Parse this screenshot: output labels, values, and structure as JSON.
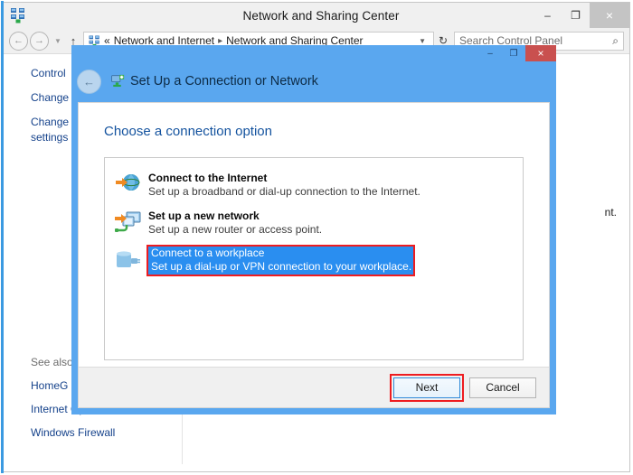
{
  "window": {
    "title": "Network and Sharing Center",
    "icon": "network-icon",
    "controls": {
      "minimize": "–",
      "maximize": "❐",
      "close": "×"
    }
  },
  "navbar": {
    "back": "←",
    "forward": "→",
    "recent_chevron": "▼",
    "up": "↑",
    "breadcrumb_prefix": "«",
    "crumbs": [
      "Network and Internet",
      "Network and Sharing Center"
    ],
    "crumb_separator": "▸",
    "address_dropdown": "▼",
    "refresh": "↻",
    "search_placeholder": "Search Control Panel",
    "search_icon": "⌕"
  },
  "sidebar": {
    "top_links": [
      "Control",
      "Change",
      "Change",
      "settings"
    ],
    "see_also_label": "See also",
    "see_also_links": [
      "HomeG",
      "Internet Options",
      "Windows Firewall"
    ]
  },
  "content_fragment": "nt.",
  "dialog": {
    "title": "Set Up a Connection or Network",
    "title_icon": "network-setup-icon",
    "back_icon": "←",
    "controls": {
      "minimize": "–",
      "maximize": "❐",
      "close": "×"
    },
    "heading": "Choose a connection option",
    "options": [
      {
        "icon": "globe-internet-icon",
        "title": "Connect to the Internet",
        "desc": "Set up a broadband or dial-up connection to the Internet.",
        "selected": false
      },
      {
        "icon": "new-network-icon",
        "title": "Set up a new network",
        "desc": "Set up a new router or access point.",
        "selected": false
      },
      {
        "icon": "workplace-vpn-icon",
        "title": "Connect to a workplace",
        "desc": "Set up a dial-up or VPN connection to your workplace.",
        "selected": true
      }
    ],
    "buttons": {
      "next": "Next",
      "cancel": "Cancel"
    }
  },
  "colors": {
    "dialog_chrome": "#5aa7ef",
    "selection_blue": "#2a8ef0",
    "annotation_red": "#ee1c20",
    "close_red": "#c9504f",
    "link_blue": "#15428b",
    "heading_blue": "#13529e"
  }
}
